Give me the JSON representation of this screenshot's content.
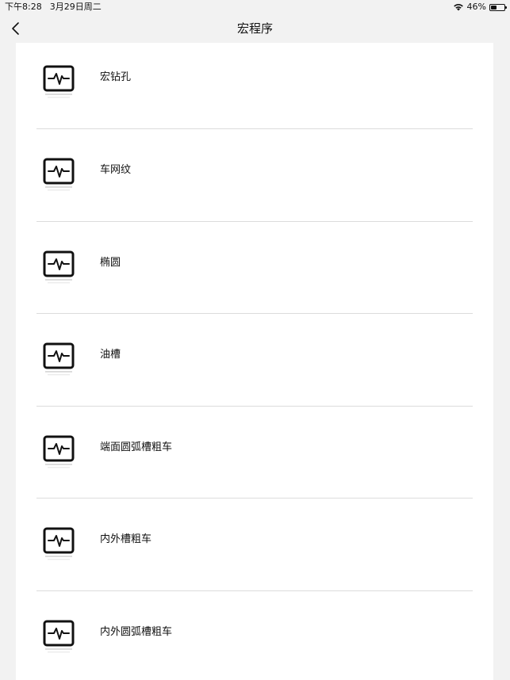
{
  "status_bar": {
    "time": "下午8:28",
    "date": "3月29日周二",
    "battery": "46%",
    "battery_level": 0.46
  },
  "nav": {
    "title": "宏程序",
    "back_icon": "chevron-left-icon"
  },
  "list": {
    "item_icon": "monitor-pulse-icon",
    "items": [
      {
        "label": "宏钻孔"
      },
      {
        "label": "车网纹"
      },
      {
        "label": "椭圆"
      },
      {
        "label": "油槽"
      },
      {
        "label": "端面圆弧槽粗车"
      },
      {
        "label": "内外槽粗车"
      },
      {
        "label": "内外圆弧槽粗车"
      }
    ]
  }
}
